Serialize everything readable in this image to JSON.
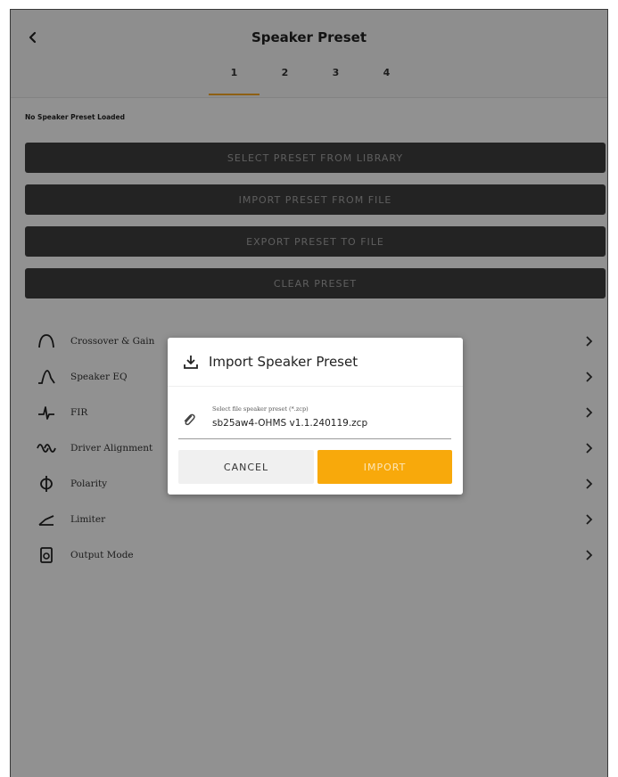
{
  "header": {
    "title": "Speaker Preset",
    "back_icon": "chevron-left-icon",
    "tabs": [
      {
        "label": "1",
        "active": true
      },
      {
        "label": "2",
        "active": false
      },
      {
        "label": "3",
        "active": false
      },
      {
        "label": "4",
        "active": false
      }
    ]
  },
  "status": {
    "text": "No Speaker Preset Loaded"
  },
  "actions": {
    "select_label": "SELECT PRESET FROM LIBRARY",
    "import_label": "IMPORT PRESET FROM FILE",
    "export_label": "EXPORT PRESET TO FILE",
    "clear_label": "CLEAR PRESET"
  },
  "menu": {
    "items": [
      {
        "label": "Crossover & Gain",
        "icon": "crossover-icon"
      },
      {
        "label": "Speaker EQ",
        "icon": "eq-curve-icon"
      },
      {
        "label": "FIR",
        "icon": "fir-icon"
      },
      {
        "label": "Driver Alignment",
        "icon": "driver-alignment-icon"
      },
      {
        "label": "Polarity",
        "icon": "polarity-icon"
      },
      {
        "label": "Limiter",
        "icon": "limiter-icon"
      },
      {
        "label": "Output Mode",
        "icon": "output-mode-icon"
      }
    ]
  },
  "dialog": {
    "title": "Import Speaker Preset",
    "title_icon": "download-icon",
    "field_label": "Select file speaker preset (*.zcp)",
    "field_value": "sb25aw4-OHMS v1.1.240119.zcp",
    "field_icon": "paperclip-icon",
    "cancel_label": "CANCEL",
    "import_label": "IMPORT"
  },
  "colors": {
    "accent": "#f8a90b",
    "button_dark": "#3d3d3d",
    "tab_indicator": "#f5a623"
  }
}
